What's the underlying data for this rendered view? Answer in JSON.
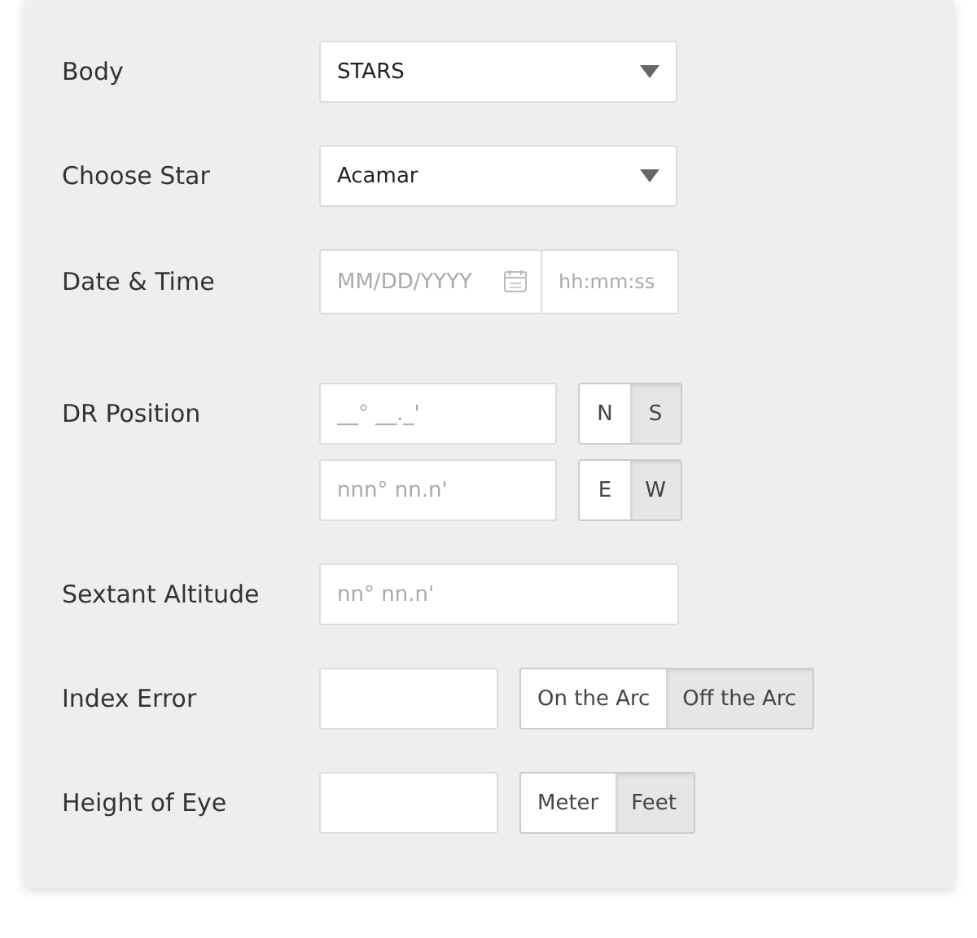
{
  "rows": [
    {
      "kind": "select",
      "label": "Body",
      "value": "STARS"
    },
    {
      "kind": "select",
      "label": "Choose Star",
      "value": "Acamar"
    },
    {
      "kind": "datetime",
      "label": "Date & Time",
      "date_placeholder": "MM/DD/YYYY",
      "time_placeholder": "hh:mm:ss"
    },
    {
      "kind": "position",
      "label": "DR Position",
      "lines": [
        {
          "placeholder": "__° __._'",
          "options": [
            {
              "label": "N",
              "selected": false
            },
            {
              "label": "S",
              "selected": true
            }
          ]
        },
        {
          "placeholder": "nnn° nn.n'",
          "options": [
            {
              "label": "E",
              "selected": false
            },
            {
              "label": "W",
              "selected": true
            }
          ]
        }
      ]
    },
    {
      "kind": "text",
      "label": "Sextant Altitude",
      "placeholder": "nn° nn.n'"
    },
    {
      "kind": "short",
      "label": "Index Error",
      "options": [
        {
          "label": "On the Arc",
          "selected": false
        },
        {
          "label": "Off the Arc",
          "selected": true
        }
      ]
    },
    {
      "kind": "short",
      "label": "Height of Eye",
      "options": [
        {
          "label": "Meter",
          "selected": false
        },
        {
          "label": "Feet",
          "selected": true
        }
      ]
    }
  ]
}
